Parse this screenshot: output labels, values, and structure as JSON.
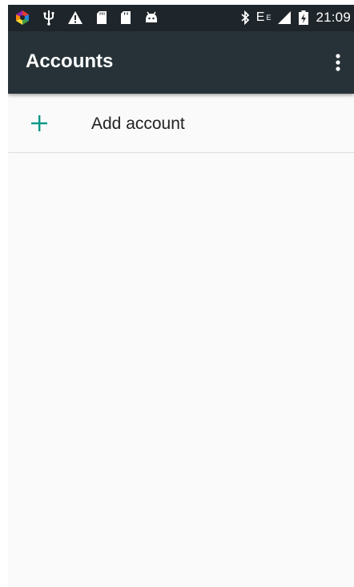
{
  "status_bar": {
    "time": "21:09",
    "network": "E",
    "network_sup": "E",
    "left_icons": [
      "color-app-icon",
      "usb-icon",
      "warning-icon",
      "sd-card-icon",
      "sd-card-icon",
      "android-debug-icon"
    ],
    "right_icons": [
      "bluetooth-icon",
      "signal-icon",
      "battery-icon"
    ]
  },
  "app_bar": {
    "title": "Accounts",
    "overflow_icon": "more-vert-icon"
  },
  "list": {
    "items": [
      {
        "label": "Add account",
        "icon": "plus-icon"
      }
    ]
  },
  "colors": {
    "status_bar_bg": "#1f262b",
    "app_bar_bg": "#263238",
    "accent": "#009688",
    "background": "#fafafa"
  }
}
